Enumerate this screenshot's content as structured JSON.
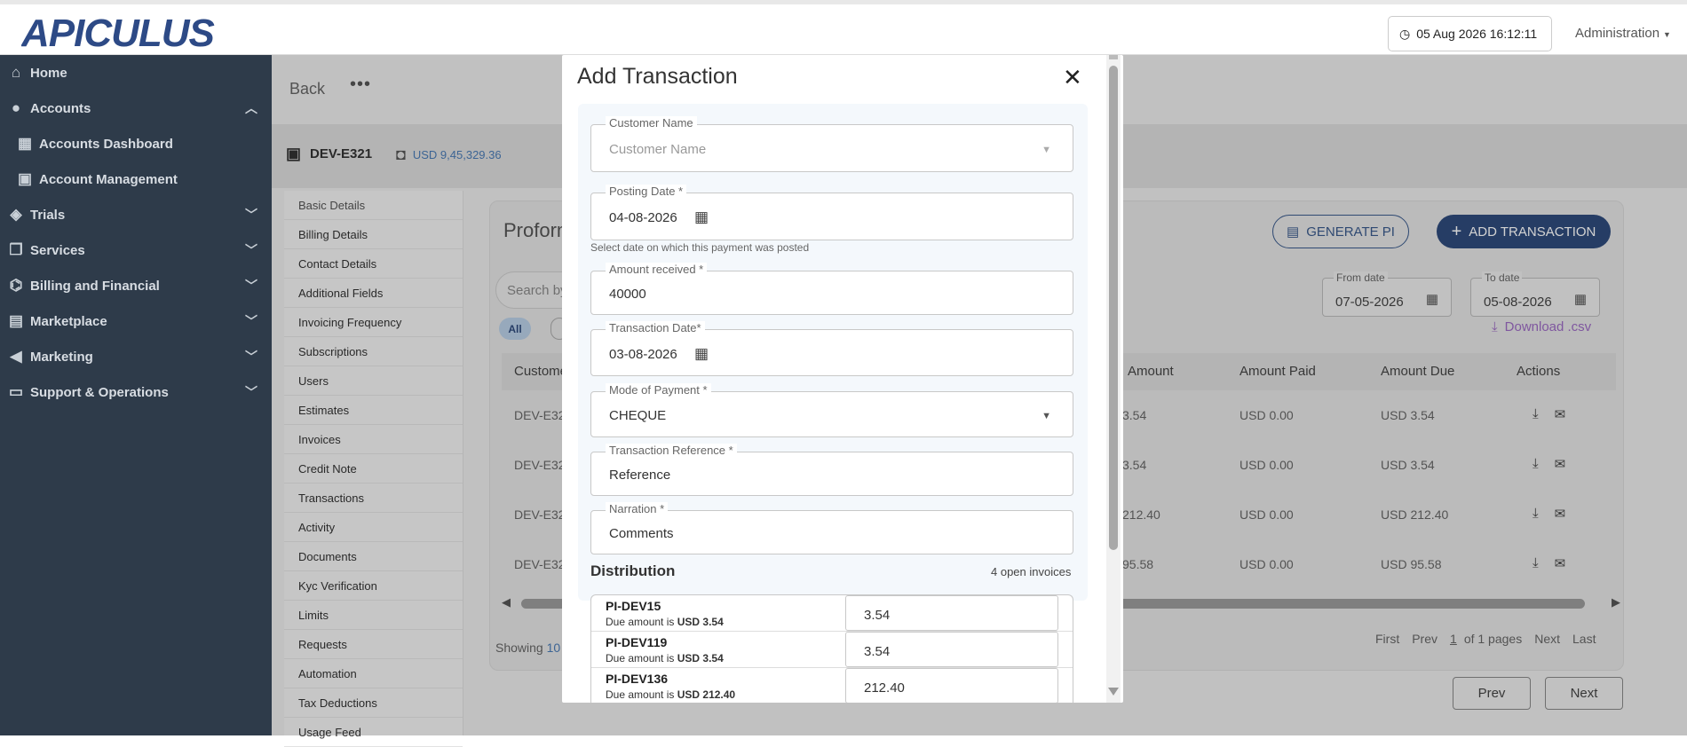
{
  "header": {
    "logo_text": "APICULUS",
    "datetime": "05 Aug 2026 16:12:11",
    "user_menu": "Administration"
  },
  "sidebar": {
    "items": [
      {
        "label": "Home",
        "icon": "home-icon"
      },
      {
        "label": "Accounts",
        "icon": "account-circle-icon",
        "expanded": true
      },
      {
        "label": "Accounts Dashboard",
        "icon": "dashboard-icon",
        "sub": true
      },
      {
        "label": "Account Management",
        "icon": "badge-icon",
        "sub": true
      },
      {
        "label": "Trials",
        "icon": "tag-icon"
      },
      {
        "label": "Services",
        "icon": "library-icon"
      },
      {
        "label": "Billing and Financial",
        "icon": "bank-icon"
      },
      {
        "label": "Marketplace",
        "icon": "store-icon"
      },
      {
        "label": "Marketing",
        "icon": "megaphone-icon"
      },
      {
        "label": "Support & Operations",
        "icon": "monitor-icon"
      }
    ]
  },
  "background": {
    "back_label": "Back",
    "more": "•••",
    "account_id": "DEV-E321",
    "balance": "USD 9,45,329.36",
    "sub_nav": [
      "Basic Details",
      "Billing Details",
      "Contact Details",
      "Additional Fields",
      "Invoicing Frequency",
      "Subscriptions",
      "Users",
      "Estimates",
      "Invoices",
      "Credit Note",
      "Transactions",
      "Activity",
      "Documents",
      "Kyc Verification",
      "Limits",
      "Requests",
      "Automation",
      "Tax Deductions",
      "Usage Feed"
    ],
    "card_title": "Proform",
    "generate_pi": "GENERATE PI",
    "add_transaction": "ADD TRANSACTION",
    "search_placeholder": "Search by",
    "from_date_label": "From date",
    "from_date": "07-05-2026",
    "to_date_label": "To date",
    "to_date": "05-08-2026",
    "download_csv": "Download .csv",
    "filter_all": "All",
    "columns": [
      "Custome",
      "Amount",
      "Amount Paid",
      "Amount Due",
      "Actions"
    ],
    "rows": [
      {
        "customer": "DEV-E32",
        "amount": "3.54",
        "paid": "USD 0.00",
        "due": "USD 3.54"
      },
      {
        "customer": "DEV-E32",
        "amount": "3.54",
        "paid": "USD 0.00",
        "due": "USD 3.54"
      },
      {
        "customer": "DEV-E32",
        "amount": "212.40",
        "paid": "USD 0.00",
        "due": "USD 212.40"
      },
      {
        "customer": "DEV-E32",
        "amount": "95.58",
        "paid": "USD 0.00",
        "due": "USD 95.58"
      }
    ],
    "showing_prefix": "Showing",
    "showing_count": "10",
    "pager": {
      "first": "First",
      "prev": "Prev",
      "page": "1",
      "of": "of 1 pages",
      "next": "Next",
      "last": "Last"
    },
    "prev_button": "Prev",
    "next_button": "Next"
  },
  "modal": {
    "title": "Add Transaction",
    "customer_label": "Customer Name",
    "customer_placeholder": "Customer Name",
    "posting_label": "Posting Date *",
    "posting_value": "04-08-2026",
    "posting_hint": "Select date on which this payment was posted",
    "amount_label": "Amount received *",
    "amount_value": "40000",
    "txdate_label": "Transaction Date*",
    "txdate_value": "03-08-2026",
    "mode_label": "Mode of Payment *",
    "mode_value": "CHEQUE",
    "ref_label": "Transaction Reference *",
    "ref_value": "Reference",
    "narration_label": "Narration *",
    "narration_value": "Comments",
    "distribution_title": "Distribution",
    "open_invoices": "4 open invoices",
    "due_prefix": "Due amount is",
    "invoices": [
      {
        "id": "PI-DEV15",
        "due": "USD 3.54",
        "amount": "3.54"
      },
      {
        "id": "PI-DEV119",
        "due": "USD 3.54",
        "amount": "3.54"
      },
      {
        "id": "PI-DEV136",
        "due": "USD 212.40",
        "amount": "212.40"
      }
    ]
  },
  "colors": {
    "sidebar": "#2e3b4a",
    "primary": "#2f4b7c",
    "logo": "#2d4a86",
    "link": "#4a7bb5",
    "csv": "#9c6bc3"
  }
}
